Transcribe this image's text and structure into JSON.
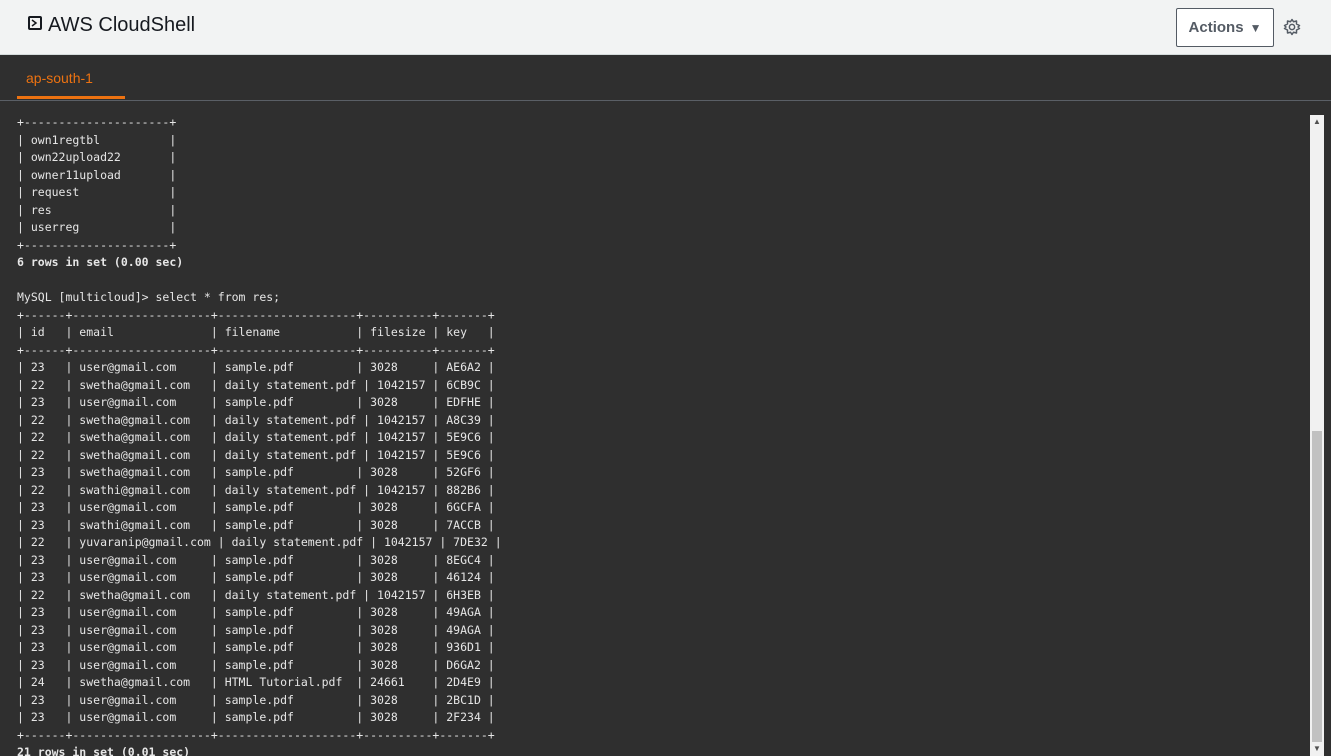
{
  "header": {
    "app_title": "AWS CloudShell",
    "actions_label": "Actions",
    "actions_caret": "▼",
    "logo_icon": "cloudshell-terminal-icon",
    "settings_icon": "gear-icon"
  },
  "tabs": [
    {
      "label": "ap-south-1",
      "active": true
    }
  ],
  "colors": {
    "accent": "#ec7211",
    "terminal_bg": "#2f2f2f",
    "header_bg": "#f2f3f3"
  },
  "terminal": {
    "lines": [
      {
        "text": "+---------------------+",
        "bold": false
      },
      {
        "text": "| own1regtbl          |",
        "bold": false
      },
      {
        "text": "| own22upload22       |",
        "bold": false
      },
      {
        "text": "| owner11upload       |",
        "bold": false
      },
      {
        "text": "| request             |",
        "bold": false
      },
      {
        "text": "| res                 |",
        "bold": false
      },
      {
        "text": "| userreg             |",
        "bold": false
      },
      {
        "text": "+---------------------+",
        "bold": false
      },
      {
        "text": "6 rows in set (0.00 sec)",
        "bold": true
      },
      {
        "text": "",
        "bold": false
      },
      {
        "text": "MySQL [multicloud]> select * from res;",
        "bold": false
      },
      {
        "text": "+------+--------------------+--------------------+----------+-------+",
        "bold": false
      },
      {
        "text": "| id   | email              | filename           | filesize | key   |",
        "bold": false
      },
      {
        "text": "+------+--------------------+--------------------+----------+-------+",
        "bold": false
      },
      {
        "text": "| 23   | user@gmail.com     | sample.pdf         | 3028     | AE6A2 |",
        "bold": false
      },
      {
        "text": "| 22   | swetha@gmail.com   | daily statement.pdf | 1042157 | 6CB9C |",
        "bold": false
      },
      {
        "text": "| 23   | user@gmail.com     | sample.pdf         | 3028     | EDFHE |",
        "bold": false
      },
      {
        "text": "| 22   | swetha@gmail.com   | daily statement.pdf | 1042157 | A8C39 |",
        "bold": false
      },
      {
        "text": "| 22   | swetha@gmail.com   | daily statement.pdf | 1042157 | 5E9C6 |",
        "bold": false
      },
      {
        "text": "| 22   | swetha@gmail.com   | daily statement.pdf | 1042157 | 5E9C6 |",
        "bold": false
      },
      {
        "text": "| 23   | swetha@gmail.com   | sample.pdf         | 3028     | 52GF6 |",
        "bold": false
      },
      {
        "text": "| 22   | swathi@gmail.com   | daily statement.pdf | 1042157 | 882B6 |",
        "bold": false
      },
      {
        "text": "| 23   | user@gmail.com     | sample.pdf         | 3028     | 6GCFA |",
        "bold": false
      },
      {
        "text": "| 23   | swathi@gmail.com   | sample.pdf         | 3028     | 7ACCB |",
        "bold": false
      },
      {
        "text": "| 22   | yuvaranip@gmail.com | daily statement.pdf | 1042157 | 7DE32 |",
        "bold": false
      },
      {
        "text": "| 23   | user@gmail.com     | sample.pdf         | 3028     | 8EGC4 |",
        "bold": false
      },
      {
        "text": "| 23   | user@gmail.com     | sample.pdf         | 3028     | 46124 |",
        "bold": false
      },
      {
        "text": "| 22   | swetha@gmail.com   | daily statement.pdf | 1042157 | 6H3EB |",
        "bold": false
      },
      {
        "text": "| 23   | user@gmail.com     | sample.pdf         | 3028     | 49AGA |",
        "bold": false
      },
      {
        "text": "| 23   | user@gmail.com     | sample.pdf         | 3028     | 49AGA |",
        "bold": false
      },
      {
        "text": "| 23   | user@gmail.com     | sample.pdf         | 3028     | 936D1 |",
        "bold": false
      },
      {
        "text": "| 23   | user@gmail.com     | sample.pdf         | 3028     | D6GA2 |",
        "bold": false
      },
      {
        "text": "| 24   | swetha@gmail.com   | HTML Tutorial.pdf  | 24661    | 2D4E9 |",
        "bold": false
      },
      {
        "text": "| 23   | user@gmail.com     | sample.pdf         | 3028     | 2BC1D |",
        "bold": false
      },
      {
        "text": "| 23   | user@gmail.com     | sample.pdf         | 3028     | 2F234 |",
        "bold": false
      },
      {
        "text": "+------+--------------------+--------------------+----------+-------+",
        "bold": false
      },
      {
        "text": "21 rows in set (0.01 sec)",
        "bold": true
      }
    ]
  }
}
